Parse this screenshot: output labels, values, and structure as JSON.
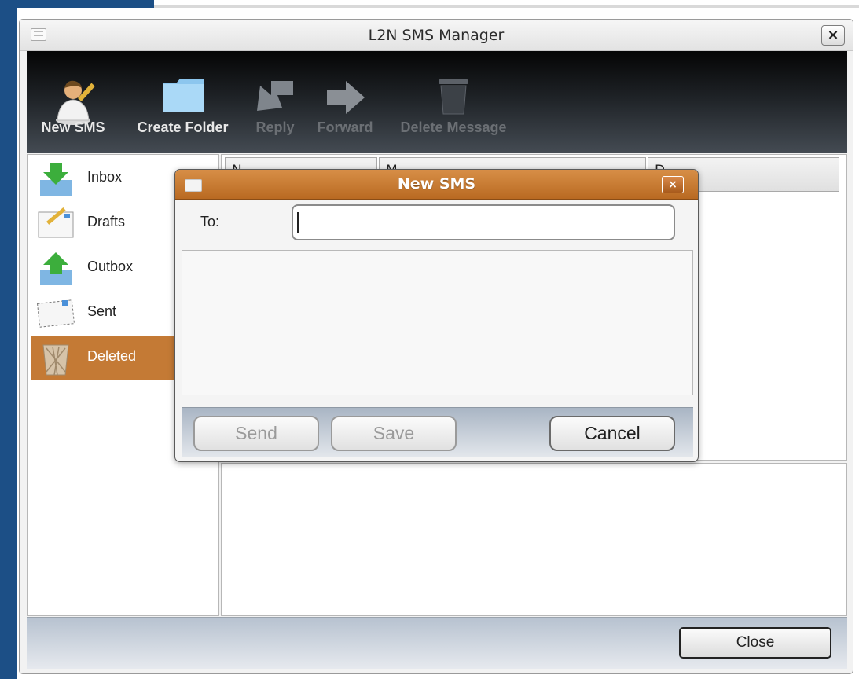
{
  "window": {
    "title": "L2N SMS Manager",
    "close_label": "×"
  },
  "toolbar": {
    "buttons": [
      {
        "label": "New SMS",
        "icon": "person-pencil-icon",
        "enabled": true
      },
      {
        "label": "Create Folder",
        "icon": "folder-icon",
        "enabled": true
      },
      {
        "label": "Reply",
        "icon": "reply-arrow-icon",
        "enabled": false
      },
      {
        "label": "Forward",
        "icon": "forward-arrow-icon",
        "enabled": false
      },
      {
        "label": "Delete Message",
        "icon": "trash-icon",
        "enabled": false
      }
    ]
  },
  "folders": {
    "items": [
      {
        "label": "Inbox",
        "icon": "inbox-icon"
      },
      {
        "label": "Drafts",
        "icon": "drafts-icon"
      },
      {
        "label": "Outbox",
        "icon": "outbox-icon"
      },
      {
        "label": "Sent",
        "icon": "sent-envelope-icon"
      },
      {
        "label": "Deleted",
        "icon": "wastebasket-icon",
        "selected": true
      }
    ],
    "selected_color": "#c47a35"
  },
  "list": {
    "columns": [
      "N",
      "M",
      "D"
    ]
  },
  "bottom": {
    "close_label": "Close"
  },
  "dialog": {
    "title": "New SMS",
    "close_label": "×",
    "to_label": "To:",
    "to_value": "",
    "message_value": "",
    "send_label": "Send",
    "save_label": "Save",
    "cancel_label": "Cancel",
    "title_color": "#c47a35"
  }
}
